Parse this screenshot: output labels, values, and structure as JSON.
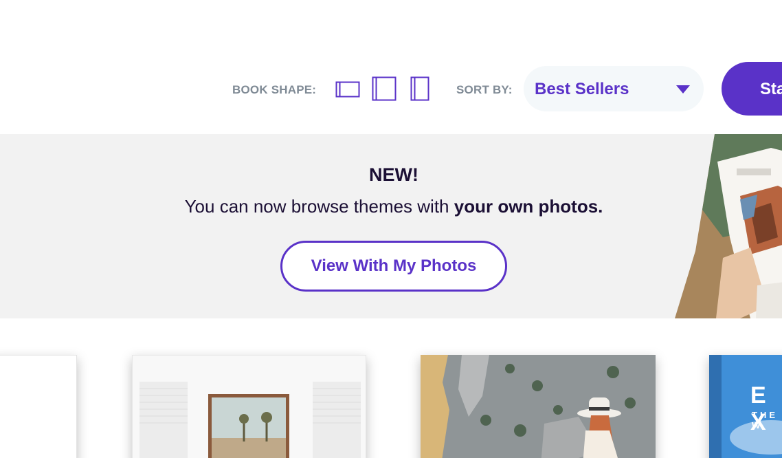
{
  "toolbar": {
    "book_shape_label": "BOOK SHAPE:",
    "shapes": [
      {
        "icon": "landscape-book-icon",
        "label": "Landscape"
      },
      {
        "icon": "square-book-icon",
        "label": "Square"
      },
      {
        "icon": "portrait-book-icon",
        "label": "Portrait"
      }
    ],
    "sort_label": "SORT BY:",
    "sort_value": "Best Sellers",
    "sort_icon": "caret-down-icon",
    "start_label": "Sta"
  },
  "banner": {
    "headline": "NEW!",
    "text_plain": "You can now browse themes with ",
    "text_bold": "your own photos.",
    "button_label": "View With My Photos",
    "photo": "hands-holding-photo-book-image"
  },
  "books": [
    {
      "name": "book-cover-white"
    },
    {
      "name": "book-cover-desert-frame"
    },
    {
      "name": "book-cover-woman-in-hat-rocks"
    },
    {
      "name": "book-cover-explore",
      "title": "E X",
      "subtitle": "THE W"
    }
  ],
  "colors": {
    "accent": "#5a32c8",
    "label_gray": "#7f8a95",
    "banner_bg": "#f2f2f2",
    "text_dark": "#1c1035"
  }
}
